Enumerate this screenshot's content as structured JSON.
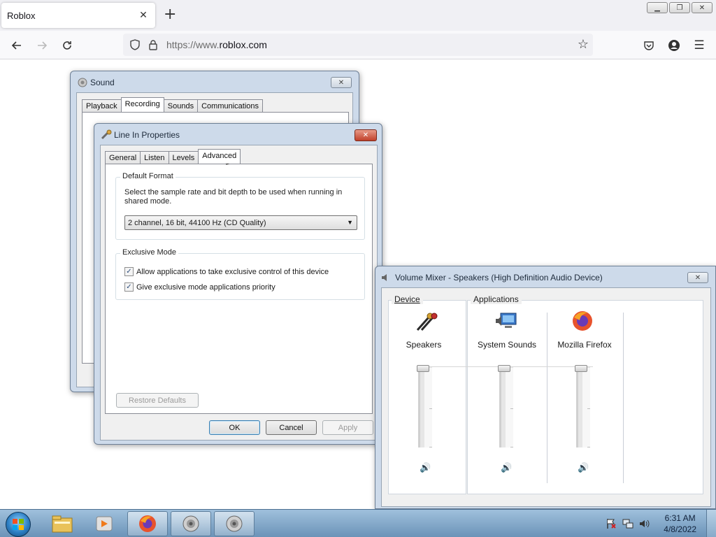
{
  "browser": {
    "tab_title": "Roblox",
    "tab_close": "✕",
    "new_tab": "+",
    "url_prefix": "https://www.",
    "url_domain": "roblox.com",
    "window_controls": {
      "minimize": "▁",
      "restore": "❐",
      "close": "✕"
    }
  },
  "sound_dialog": {
    "title": "Sound",
    "tabs": [
      "Playback",
      "Recording",
      "Sounds",
      "Communications"
    ],
    "active_tab": "Recording",
    "close": "✕"
  },
  "line_in": {
    "title": "Line In Properties",
    "close": "✕",
    "tabs": [
      "General",
      "Listen",
      "Levels",
      "Advanced"
    ],
    "active_tab": "Advanced",
    "default_format": {
      "label": "Default Format",
      "description": "Select the sample rate and bit depth to be used when running in shared mode.",
      "selected": "2 channel, 16 bit, 44100 Hz (CD Quality)"
    },
    "exclusive_mode": {
      "label": "Exclusive Mode",
      "options": [
        {
          "label": "Allow applications to take exclusive control of this device",
          "checked": true
        },
        {
          "label": "Give exclusive mode applications priority",
          "checked": true
        }
      ]
    },
    "restore_defaults": "Restore Defaults",
    "ok": "OK",
    "cancel": "Cancel",
    "apply": "Apply"
  },
  "volume_mixer": {
    "title": "Volume Mixer - Speakers (High Definition Audio Device)",
    "close": "✕",
    "device_label": "Device",
    "applications_label": "Applications",
    "channels": [
      {
        "name": "Speakers",
        "icon": "speakers-icon",
        "level": 1.0
      },
      {
        "name": "System Sounds",
        "icon": "system-sounds-icon",
        "level": 1.0
      },
      {
        "name": "Mozilla Firefox",
        "icon": "firefox-icon",
        "level": 1.0
      }
    ]
  },
  "taskbar": {
    "time": "6:31 AM",
    "date": "4/8/2022",
    "pinned": [
      "start-orb",
      "explorer-icon",
      "media-player-icon",
      "firefox-icon",
      "sound-icon",
      "sound-icon"
    ]
  },
  "colors": {
    "accent": "#3c7fb1",
    "close_red": "#c0402a",
    "taskbar": "#6b93b8"
  }
}
